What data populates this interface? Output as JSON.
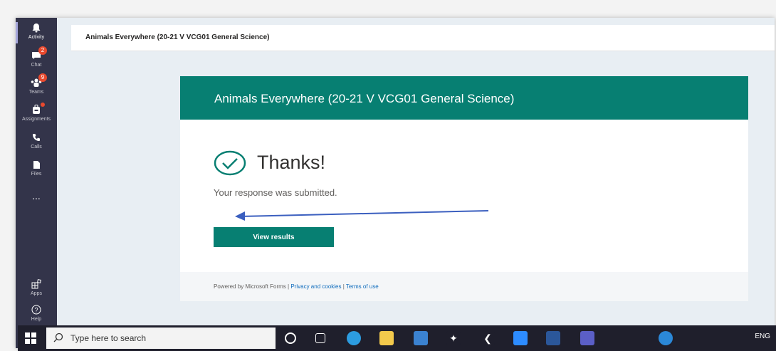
{
  "rail": {
    "items": [
      {
        "label": "Activity"
      },
      {
        "label": "Chat",
        "badge": "2"
      },
      {
        "label": "Teams",
        "badge": "9"
      },
      {
        "label": "Assignments"
      },
      {
        "label": "Calls"
      },
      {
        "label": "Files"
      },
      {
        "label": "..."
      },
      {
        "label": "Apps"
      },
      {
        "label": "Help"
      }
    ]
  },
  "topbar": {
    "title": "Animals Everywhere (20-21 V VCG01 General Science)"
  },
  "form": {
    "header_title": "Animals Everywhere (20-21 V VCG01 General Science)",
    "thanks": "Thanks!",
    "submitted": "Your response was submitted.",
    "view_results": "View results",
    "footer": {
      "powered": "Powered by Microsoft Forms |",
      "privacy": "Privacy and cookies",
      "sep": "|",
      "terms": "Terms of use"
    }
  },
  "taskbar": {
    "search_placeholder": "Type here to search",
    "tray_lang": "ENG"
  },
  "colors": {
    "accent": "#077f72",
    "rail": "#33344a",
    "arrow": "#3b5fbf"
  }
}
